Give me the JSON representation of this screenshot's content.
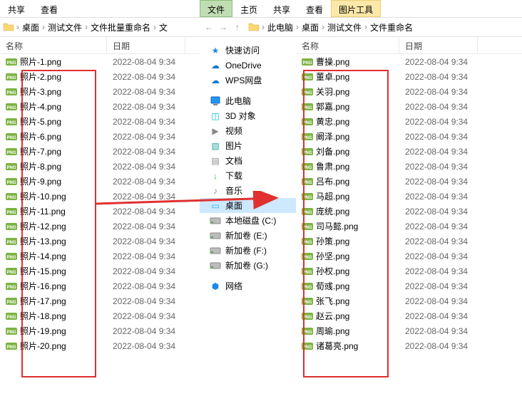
{
  "left": {
    "tabs": [
      "共享",
      "查看"
    ],
    "breadcrumb": [
      "桌面",
      "测试文件",
      "文件批量重命名",
      "文"
    ],
    "columns": {
      "name": "名称",
      "date": "日期"
    },
    "files": [
      {
        "name": "照片-1.png",
        "date": "2022-08-04 9:34"
      },
      {
        "name": "照片-2.png",
        "date": "2022-08-04 9:34"
      },
      {
        "name": "照片-3.png",
        "date": "2022-08-04 9:34"
      },
      {
        "name": "照片-4.png",
        "date": "2022-08-04 9:34"
      },
      {
        "name": "照片-5.png",
        "date": "2022-08-04 9:34"
      },
      {
        "name": "照片-6.png",
        "date": "2022-08-04 9:34"
      },
      {
        "name": "照片-7.png",
        "date": "2022-08-04 9:34"
      },
      {
        "name": "照片-8.png",
        "date": "2022-08-04 9:34"
      },
      {
        "name": "照片-9.png",
        "date": "2022-08-04 9:34"
      },
      {
        "name": "照片-10.png",
        "date": "2022-08-04 9:34"
      },
      {
        "name": "照片-11.png",
        "date": "2022-08-04 9:34"
      },
      {
        "name": "照片-12.png",
        "date": "2022-08-04 9:34"
      },
      {
        "name": "照片-13.png",
        "date": "2022-08-04 9:34"
      },
      {
        "name": "照片-14.png",
        "date": "2022-08-04 9:34"
      },
      {
        "name": "照片-15.png",
        "date": "2022-08-04 9:34"
      },
      {
        "name": "照片-16.png",
        "date": "2022-08-04 9:34"
      },
      {
        "name": "照片-17.png",
        "date": "2022-08-04 9:34"
      },
      {
        "name": "照片-18.png",
        "date": "2022-08-04 9:34"
      },
      {
        "name": "照片-19.png",
        "date": "2022-08-04 9:34"
      },
      {
        "name": "照片-20.png",
        "date": "2022-08-04 9:34"
      }
    ]
  },
  "right": {
    "tabs": [
      {
        "label": "文件",
        "style": "active"
      },
      {
        "label": "主页",
        "style": ""
      },
      {
        "label": "共享",
        "style": ""
      },
      {
        "label": "查看",
        "style": ""
      },
      {
        "label": "图片工具",
        "style": "highlight"
      }
    ],
    "breadcrumb": [
      "此电脑",
      "桌面",
      "测试文件",
      "文件重命名"
    ],
    "columns": {
      "name": "名称",
      "date": "日期"
    },
    "sidebar": {
      "group1": [
        {
          "icon": "quick",
          "label": "快速访问"
        },
        {
          "icon": "onedrive",
          "label": "OneDrive"
        },
        {
          "icon": "wps",
          "label": "WPS网盘"
        }
      ],
      "group2": [
        {
          "icon": "pc",
          "label": "此电脑"
        },
        {
          "icon": "3d",
          "label": "3D 对象"
        },
        {
          "icon": "video",
          "label": "视频"
        },
        {
          "icon": "pictures",
          "label": "图片"
        },
        {
          "icon": "documents",
          "label": "文档"
        },
        {
          "icon": "downloads",
          "label": "下载"
        },
        {
          "icon": "music",
          "label": "音乐"
        },
        {
          "icon": "desktop",
          "label": "桌面",
          "selected": true
        },
        {
          "icon": "disk",
          "label": "本地磁盘 (C:)"
        },
        {
          "icon": "disk",
          "label": "新加卷 (E:)"
        },
        {
          "icon": "disk",
          "label": "新加卷 (F:)"
        },
        {
          "icon": "disk",
          "label": "新加卷 (G:)"
        }
      ],
      "group3": [
        {
          "icon": "network",
          "label": "网络"
        }
      ]
    },
    "files": [
      {
        "name": "曹操.png",
        "date": "2022-08-04 9:34"
      },
      {
        "name": "董卓.png",
        "date": "2022-08-04 9:34"
      },
      {
        "name": "关羽.png",
        "date": "2022-08-04 9:34"
      },
      {
        "name": "郭嘉.png",
        "date": "2022-08-04 9:34"
      },
      {
        "name": "黄忠.png",
        "date": "2022-08-04 9:34"
      },
      {
        "name": "阚泽.png",
        "date": "2022-08-04 9:34"
      },
      {
        "name": "刘备.png",
        "date": "2022-08-04 9:34"
      },
      {
        "name": "鲁肃.png",
        "date": "2022-08-04 9:34"
      },
      {
        "name": "吕布.png",
        "date": "2022-08-04 9:34"
      },
      {
        "name": "马超.png",
        "date": "2022-08-04 9:34"
      },
      {
        "name": "庞统.png",
        "date": "2022-08-04 9:34"
      },
      {
        "name": "司马懿.png",
        "date": "2022-08-04 9:34"
      },
      {
        "name": "孙策.png",
        "date": "2022-08-04 9:34"
      },
      {
        "name": "孙坚.png",
        "date": "2022-08-04 9:34"
      },
      {
        "name": "孙权.png",
        "date": "2022-08-04 9:34"
      },
      {
        "name": "荀彧.png",
        "date": "2022-08-04 9:34"
      },
      {
        "name": "张飞.png",
        "date": "2022-08-04 9:34"
      },
      {
        "name": "赵云.png",
        "date": "2022-08-04 9:34"
      },
      {
        "name": "周瑜.png",
        "date": "2022-08-04 9:34"
      },
      {
        "name": "诸葛亮.png",
        "date": "2022-08-04 9:34"
      }
    ]
  },
  "icons": {
    "folder_color": "#f8d775",
    "png_badge": "PNG"
  }
}
